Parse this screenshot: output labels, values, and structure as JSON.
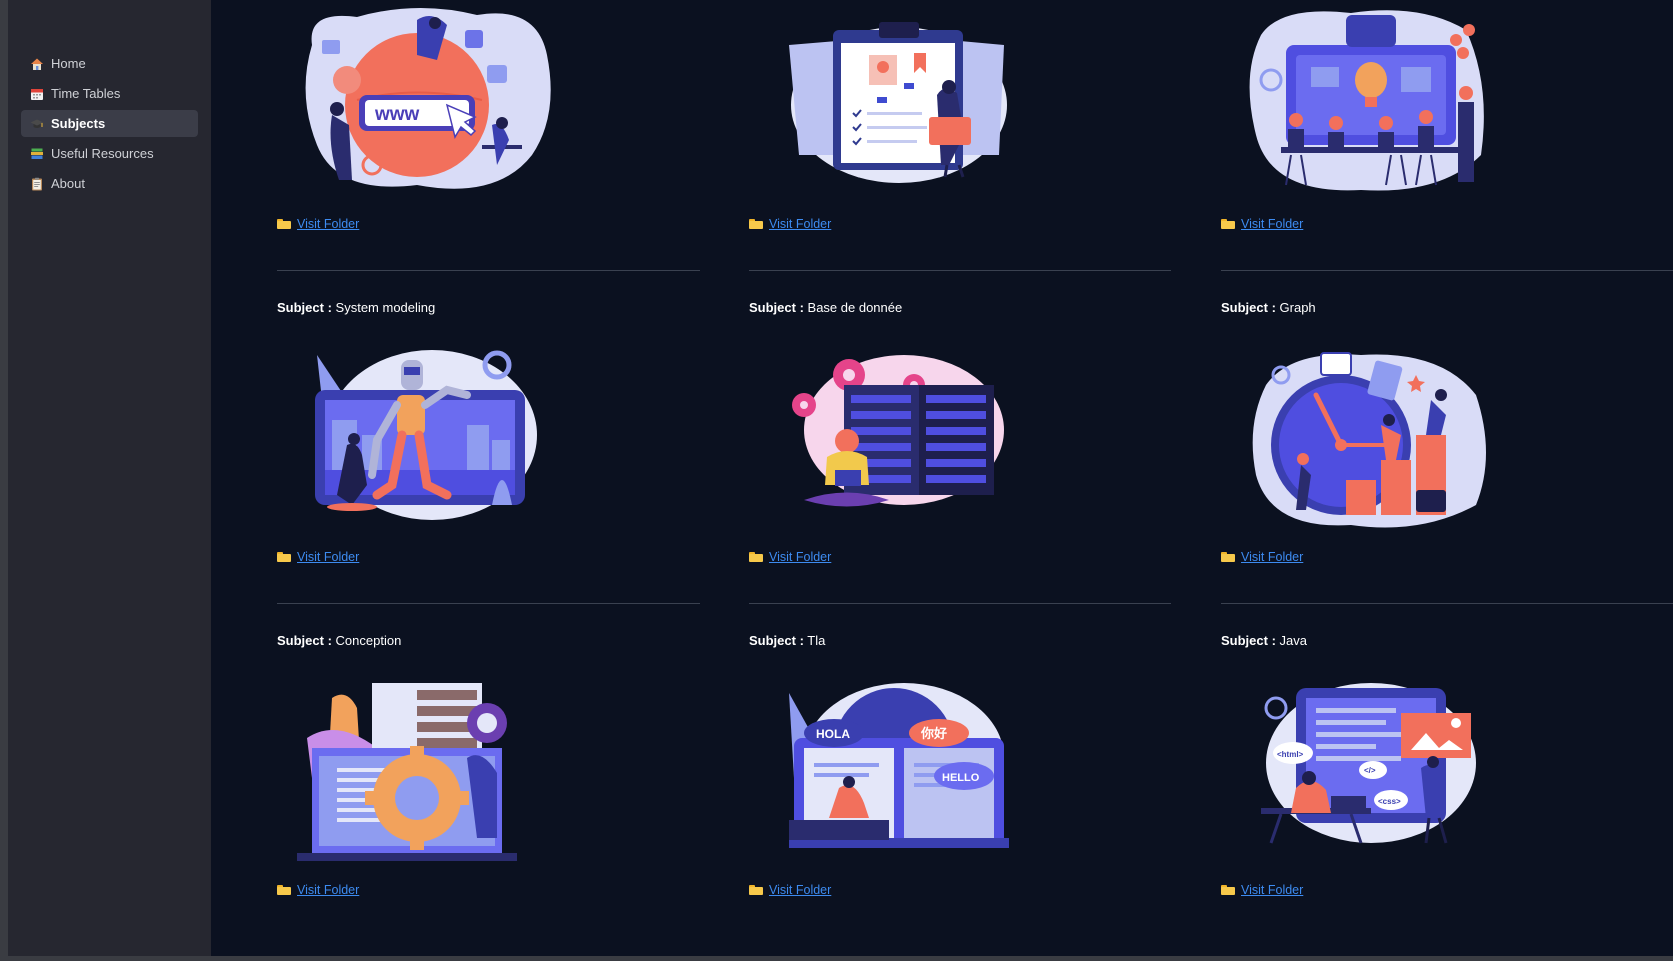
{
  "sidebar": {
    "items": [
      {
        "label": "Home",
        "icon": "house-icon",
        "active": false
      },
      {
        "label": "Time Tables",
        "icon": "calendar-icon",
        "active": false
      },
      {
        "label": "Subjects",
        "icon": "graduation-cap-icon",
        "active": true
      },
      {
        "label": "Useful Resources",
        "icon": "books-icon",
        "active": false
      },
      {
        "label": "About",
        "icon": "clipboard-icon",
        "active": false
      }
    ]
  },
  "main": {
    "link_label": "Visit Folder",
    "subject_prefix": "Subject :",
    "rows": [
      {
        "cards": [
          {
            "subject": "",
            "illustration": "website-globe-illustration"
          },
          {
            "subject": "",
            "illustration": "clipboard-resume-illustration"
          },
          {
            "subject": "",
            "illustration": "team-office-illustration"
          }
        ]
      },
      {
        "cards": [
          {
            "subject": "System modeling",
            "illustration": "robot-city-illustration"
          },
          {
            "subject": "Base de donnée",
            "illustration": "server-database-illustration"
          },
          {
            "subject": "Graph",
            "illustration": "clock-growth-chart-illustration"
          }
        ]
      },
      {
        "cards": [
          {
            "subject": "Conception",
            "illustration": "gear-code-illustration"
          },
          {
            "subject": "Tla",
            "illustration": "languages-book-illustration",
            "bubbles": [
              "HOLA",
              "你好",
              "HELLO"
            ]
          },
          {
            "subject": "Java",
            "illustration": "web-developer-illustration",
            "bubbles": [
              "<html>",
              "</>",
              "<css>"
            ]
          }
        ]
      }
    ]
  },
  "colors": {
    "background": "#0b1120",
    "sidebar": "#262730",
    "link": "#3d8bf0",
    "accent_blue": "#4f4ee0",
    "accent_coral": "#f2705c"
  }
}
